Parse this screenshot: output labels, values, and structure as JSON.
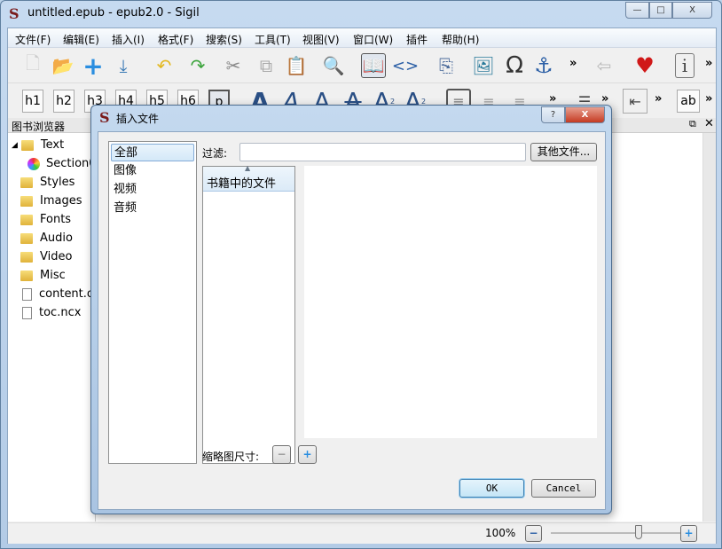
{
  "window": {
    "title": "untitled.epub - epub2.0 - Sigil",
    "logo": "S",
    "minimize": "—",
    "maximize": "□",
    "close": "X"
  },
  "menu": [
    "文件(F)",
    "编辑(E)",
    "插入(I)",
    "格式(F)",
    "搜索(S)",
    "工具(T)",
    "视图(V)",
    "窗口(W)",
    "插件",
    "帮助(H)"
  ],
  "toolbar2": {
    "headings": [
      "h1",
      "h2",
      "h3",
      "h4",
      "h5",
      "h6",
      "p"
    ],
    "ab": "ab",
    "more": "»"
  },
  "book_browser": {
    "title": "图书浏览器",
    "items": [
      {
        "label": "Text",
        "type": "folder"
      },
      {
        "label": "Section0001.xhtml",
        "type": "section"
      },
      {
        "label": "Styles",
        "type": "folder"
      },
      {
        "label": "Images",
        "type": "folder"
      },
      {
        "label": "Fonts",
        "type": "folder"
      },
      {
        "label": "Audio",
        "type": "folder"
      },
      {
        "label": "Video",
        "type": "folder"
      },
      {
        "label": "Misc",
        "type": "folder"
      },
      {
        "label": "content.opf",
        "type": "file"
      },
      {
        "label": "toc.ncx",
        "type": "file"
      }
    ]
  },
  "status": {
    "zoom": "100%",
    "zoom_fraction": 0.5
  },
  "dialog": {
    "title": "插入文件",
    "help": "?",
    "close": "X",
    "categories": [
      "全部",
      "图像",
      "视频",
      "音频"
    ],
    "selected_category": "全部",
    "filter_label": "过滤:",
    "filter_value": "",
    "other_files": "其他文件...",
    "file_column": "书籍中的文件",
    "thumb_label": "缩略图尺寸:",
    "ok": "OK",
    "cancel": "Cancel"
  }
}
